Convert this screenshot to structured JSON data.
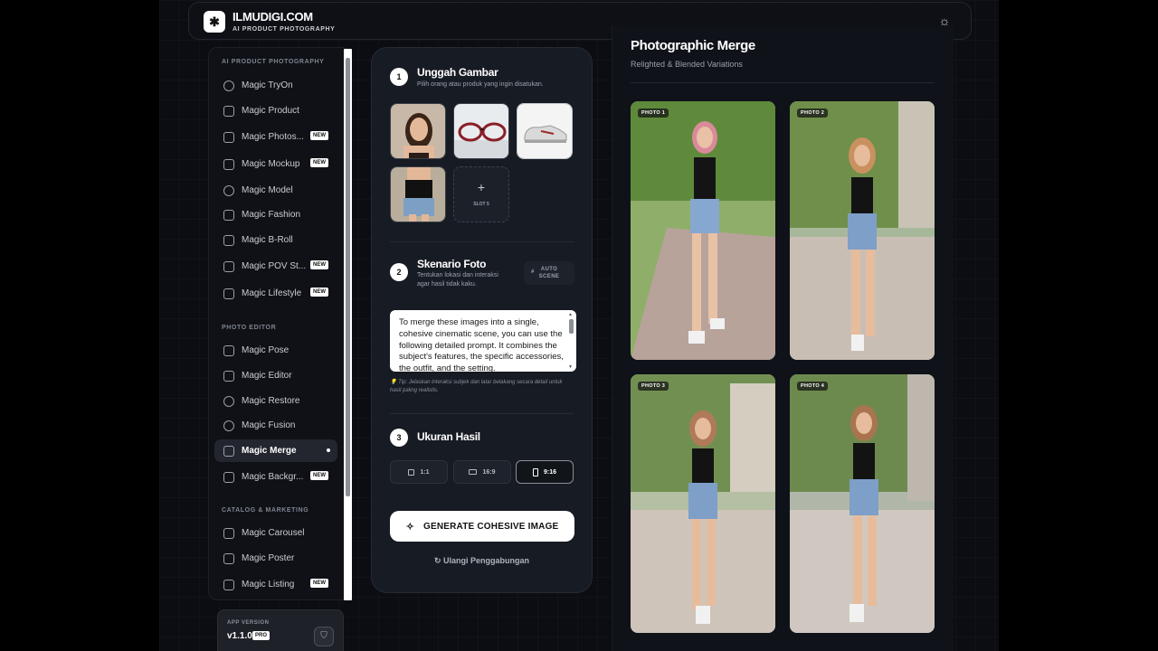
{
  "header": {
    "brand_name": "ILMUDIGI.COM",
    "brand_sub": "AI PRODUCT PHOTOGRAPHY",
    "logo_icon": "sparkle-icon",
    "theme_icon": "sun-icon"
  },
  "sidebar": {
    "sections": [
      {
        "title": "AI PRODUCT PHOTOGRAPHY",
        "items": [
          {
            "label": "Magic TryOn",
            "icon": "person-icon",
            "badge": ""
          },
          {
            "label": "Magic Product",
            "icon": "camera-icon",
            "badge": ""
          },
          {
            "label": "Magic Photos...",
            "icon": "camera-icon",
            "badge": "NEW"
          },
          {
            "label": "Magic Mockup",
            "icon": "shirt-icon",
            "badge": "NEW"
          },
          {
            "label": "Magic Model",
            "icon": "person-icon",
            "badge": ""
          },
          {
            "label": "Magic Fashion",
            "icon": "shirt-icon",
            "badge": ""
          },
          {
            "label": "Magic B-Roll",
            "icon": "video-icon",
            "badge": ""
          },
          {
            "label": "Magic POV St...",
            "icon": "hand-icon",
            "badge": "NEW"
          },
          {
            "label": "Magic Lifestyle",
            "icon": "scan-icon",
            "badge": "NEW"
          }
        ]
      },
      {
        "title": "PHOTO EDITOR",
        "items": [
          {
            "label": "Magic Pose",
            "icon": "figure-icon",
            "badge": ""
          },
          {
            "label": "Magic Editor",
            "icon": "sparkle-icon",
            "badge": ""
          },
          {
            "label": "Magic Restore",
            "icon": "history-icon",
            "badge": ""
          },
          {
            "label": "Magic Fusion",
            "icon": "circles-icon",
            "badge": ""
          },
          {
            "label": "Magic Merge",
            "icon": "copy-icon",
            "badge": "",
            "active": true
          },
          {
            "label": "Magic Backgr...",
            "icon": "image-icon",
            "badge": "NEW"
          }
        ]
      },
      {
        "title": "CATALOG & MARKETING",
        "items": [
          {
            "label": "Magic Carousel",
            "icon": "plus-square-icon",
            "badge": ""
          },
          {
            "label": "Magic Poster",
            "icon": "file-icon",
            "badge": ""
          },
          {
            "label": "Magic Listing",
            "icon": "clipboard-icon",
            "badge": "NEW"
          }
        ]
      }
    ],
    "version": {
      "label": "APP VERSION",
      "number": "v1.1.0",
      "tier": "PRO"
    }
  },
  "panel": {
    "step1": {
      "num": "1",
      "title": "Unggah Gambar",
      "sub": "Pilih orang atau produk yang ingin disatukan."
    },
    "slots": [
      {
        "name": "woman-portrait"
      },
      {
        "name": "glasses"
      },
      {
        "name": "sneakers"
      },
      {
        "name": "outfit"
      }
    ],
    "empty_slot": {
      "plus": "+",
      "label": "SLOT 5"
    },
    "step2": {
      "num": "2",
      "title": "Skenario Foto",
      "sub_line1": "Tentukan lokasi dan interaksi",
      "sub_line2": "agar hasil tidak kaku."
    },
    "auto_scene": {
      "line1": "AUTO",
      "line2": "SCENE",
      "hash": "#"
    },
    "prompt": "To merge these images into a single, cohesive cinematic scene, you can use the following detailed prompt. It combines the subject's features, the specific accessories, the outfit, and the setting.",
    "tip": "💡 Tip: Jelaskan interaksi subjek dan latar belakang secara detail untuk hasil paling realistis.",
    "step3": {
      "num": "3",
      "title": "Ukuran Hasil"
    },
    "ratios": [
      {
        "label": "1:1",
        "active": false
      },
      {
        "label": "16:9",
        "active": false
      },
      {
        "label": "9:16",
        "active": true
      }
    ],
    "generate_label": "GENERATE COHESIVE IMAGE",
    "redo_label": "Ulangi Penggabungan"
  },
  "results": {
    "title": "Photographic Merge",
    "subtitle": "Relighted & Blended Variations",
    "photos": [
      "PHOTO 1",
      "PHOTO 2",
      "PHOTO 3",
      "PHOTO 4"
    ]
  }
}
